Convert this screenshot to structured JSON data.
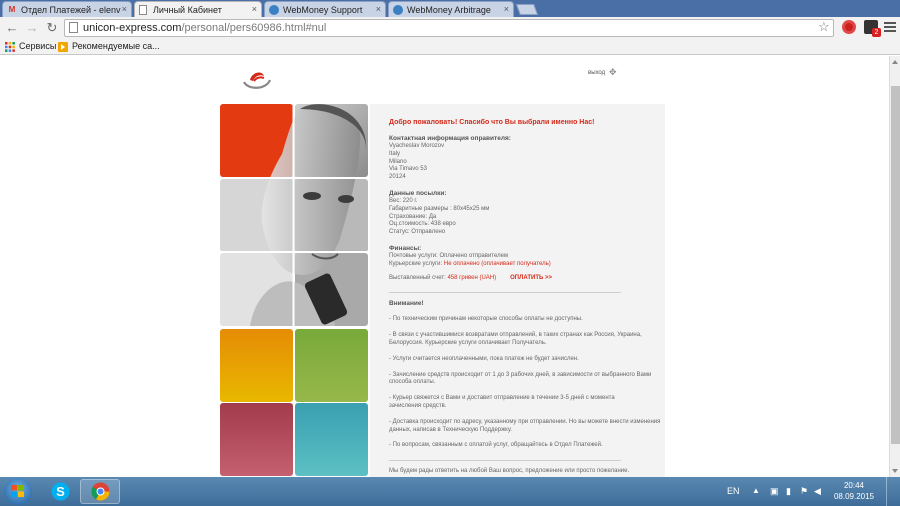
{
  "tabs": [
    {
      "title": "Отдел Платежей - elenv",
      "icon": "gmail-icon",
      "active": false
    },
    {
      "title": "Личный Кабинет",
      "icon": "page-icon",
      "active": true
    },
    {
      "title": "WebMoney Support",
      "icon": "webmoney-icon",
      "active": false
    },
    {
      "title": "WebMoney Arbitrage",
      "icon": "webmoney-icon",
      "active": false
    }
  ],
  "tab_close_glyph": "×",
  "toolbar": {
    "back": "←",
    "forward": "→",
    "reload": "↻",
    "url_host": "unicon-express.com",
    "url_path": "/personal/pers60986.html#nul",
    "star": "☆"
  },
  "ext_badge": "2",
  "bookmarks": [
    {
      "label": "Сервисы",
      "icon": "apps-grid-icon"
    },
    {
      "label": "Рекомендуемые са...",
      "icon": "bookmark-icon"
    }
  ],
  "page": {
    "logout": "выход",
    "welcome": "Добро пожаловать! Спасибо что Вы выбрали именно Нас!",
    "sender_heading": "Контактная информация оправителя:",
    "sender_lines": [
      "Vyacheslav Morozov",
      "Italy",
      "Milano",
      "Via Timavo 53",
      "20124"
    ],
    "parcel_heading": "Данные посылки:",
    "parcel_lines": [
      "Вес: 220 г.",
      "Габаритные размеры : 80х45х25 мм",
      "Страхование: Да",
      "Оц.стоимость: 438 евро",
      "Статус: Отправлено"
    ],
    "finance_heading": "Финансы:",
    "postal_line": "Почтовые услуги: Оплачено отправителем",
    "courier_label": "Курьерские услуги: ",
    "courier_value": "Не оплачено (оплачивает получатель)",
    "invoice_label": "Выставленный счет: ",
    "invoice_value": "458 гривен (UAH)",
    "pay_label": "ОПЛАТИТЬ >>",
    "attention_heading": "Внимание!",
    "notes": [
      "- По техническим причинам некоторые способы оплаты не доступны.",
      "- В связи с участившимися возвратами отправлений, в таких странах как Россия, Украина, Белоруссия. Курьерские услуги оплачивает Получатель.",
      "- Услуги считается неоплаченными, пока платеж не будет зачислен.",
      "- Зачисление средств происходит от 1 до 3 рабочих дней, в зависимости от выбранного Вами способа оплаты.",
      "- Курьер свяжется с Вами и доставит отправление в течении 3-5 дней с момента зачисления средств.",
      "- Доставка происходит по адресу, указанному при отправлении. Но вы можете внести изменения данных, написав в Техническую Поддержку.",
      "- По вопросам, связанным с оплатой услуг, обращайтесь в Отдел Платежей."
    ],
    "footer_text": "Мы будем рады ответить на любой Ваш вопрос, предложение или просто пожелание."
  },
  "colors": {
    "accent_red": "#d42a1a",
    "tile_red": "#e33a12",
    "tile_orange": "#e8a000",
    "tile_green": "#86b03c",
    "tile_rose": "#b84a5a",
    "tile_teal": "#48aeb8"
  },
  "taskbar": {
    "lang": "EN",
    "time": "20:44",
    "date": "08.09.2015"
  }
}
